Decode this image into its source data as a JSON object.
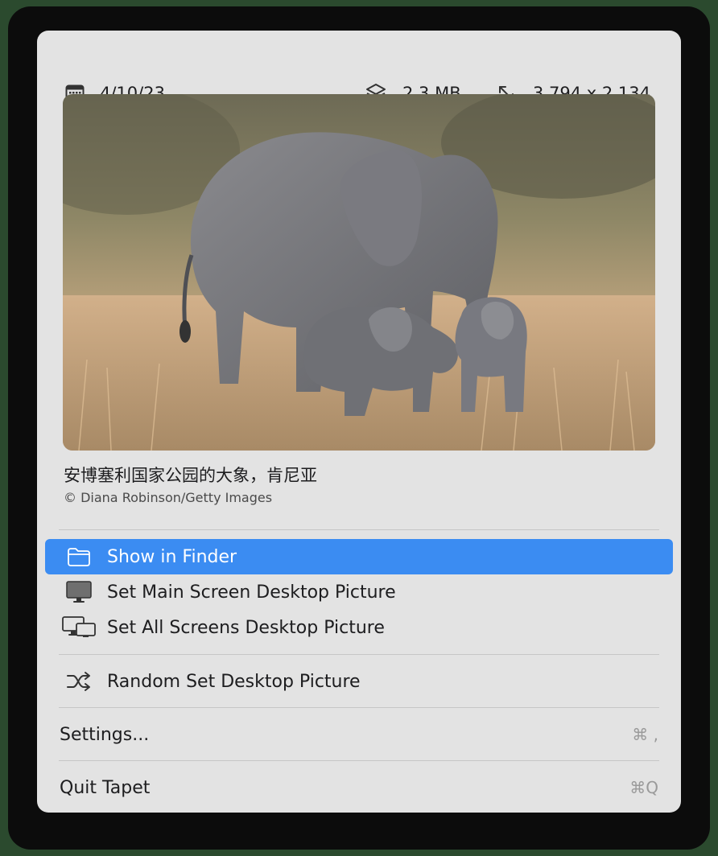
{
  "info": {
    "date": "4/10/23",
    "file_size": "2.3 MB",
    "dimensions": "3,794 x 2,134"
  },
  "photo": {
    "caption": "安博塞利国家公园的大象，肯尼亚",
    "credit": "© Diana Robinson/Getty Images"
  },
  "menu": {
    "show_in_finder": "Show in Finder",
    "set_main": "Set Main Screen Desktop Picture",
    "set_all": "Set All Screens Desktop Picture",
    "random_set": "Random Set Desktop Picture",
    "settings": "Settings...",
    "settings_shortcut": "⌘ ,",
    "quit": "Quit Tapet",
    "quit_shortcut": "⌘Q"
  },
  "colors": {
    "highlight": "#3b8cf2",
    "menu_background": "#e3e3e3"
  },
  "icons": [
    "calendar-icon",
    "layers-icon",
    "resize-arrows-icon",
    "folder-icon",
    "monitor-icon",
    "multiple-monitors-icon",
    "shuffle-icon"
  ]
}
